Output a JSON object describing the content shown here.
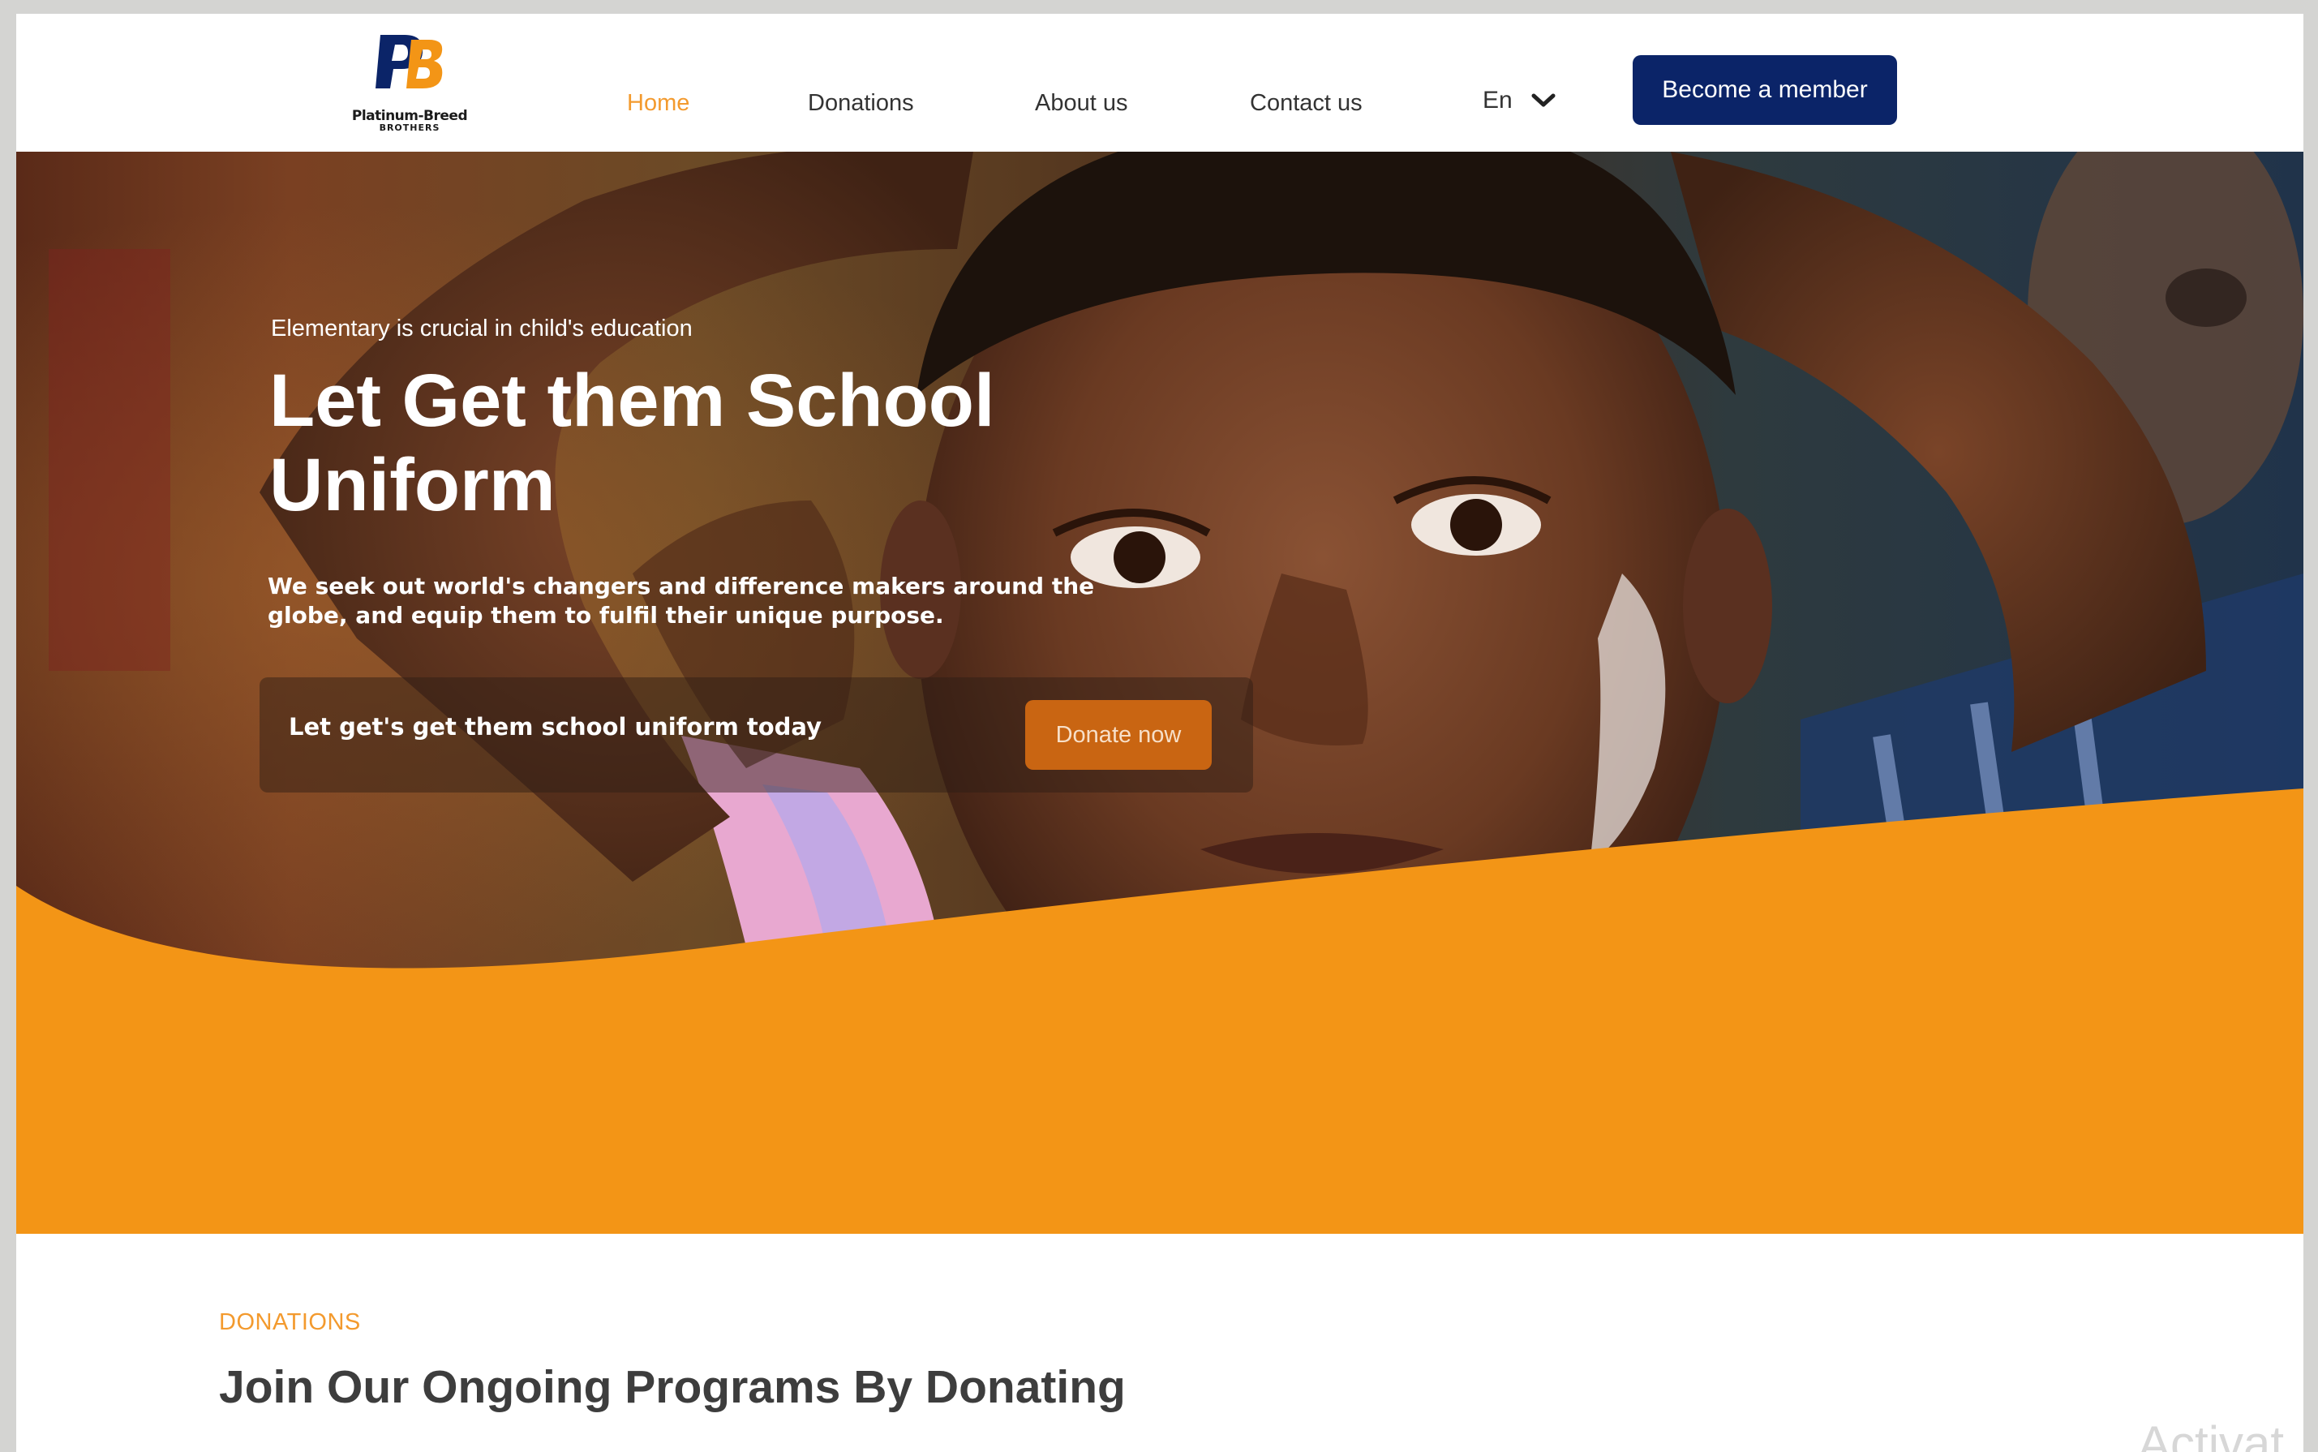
{
  "header": {
    "logo_text": "Platinum-Breed",
    "logo_subtext": "BROTHERS",
    "nav": [
      {
        "label": "Home",
        "active": true
      },
      {
        "label": "Donations",
        "active": false
      },
      {
        "label": "About us",
        "active": false
      },
      {
        "label": "Contact us",
        "active": false
      }
    ],
    "language": "En",
    "member_button": "Become a member"
  },
  "hero": {
    "eyebrow": "Elementary is crucial in child's education",
    "title": "Let Get them School Uniform",
    "description": "We seek out world's changers and difference makers around the globe, and equip them to fulfil their unique purpose.",
    "cta_text": "Let get's get them school uniform today",
    "donate_button": "Donate now"
  },
  "donations": {
    "label": "DONATIONS",
    "title": "Join Our Ongoing Programs By Donating"
  },
  "watermark": "Activat",
  "colors": {
    "accent": "#f39a2e",
    "wave": "#f39516",
    "primary": "#0b2468",
    "donate": "#c96512"
  },
  "icons": {
    "logo": "pb-logo-icon",
    "language_toggle": "chevron-down-icon"
  }
}
